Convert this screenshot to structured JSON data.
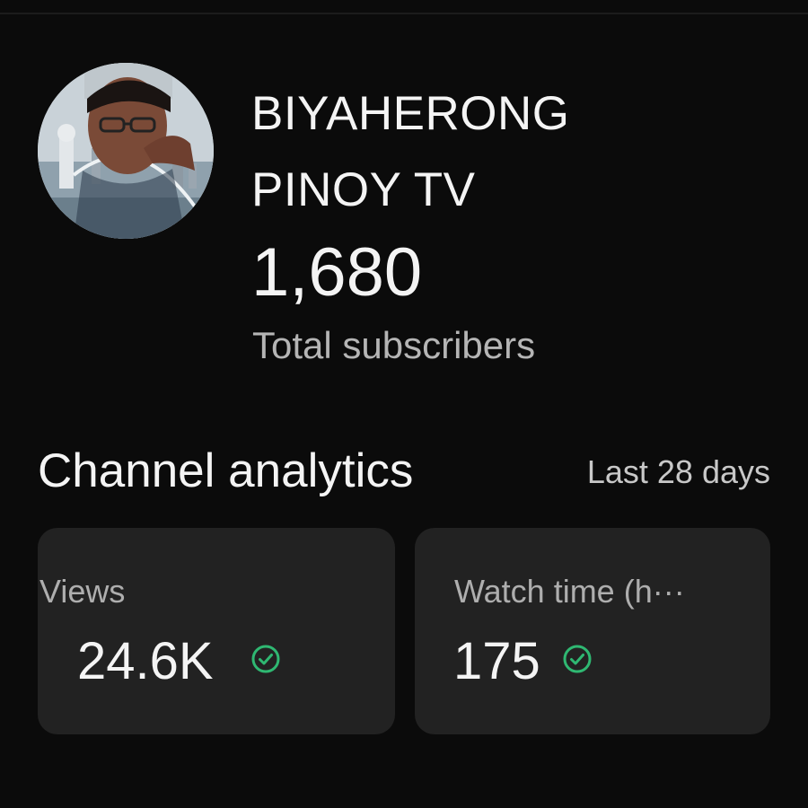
{
  "channel": {
    "name_line1": "BIYAHERONG",
    "name_line2": "PINOY TV",
    "subscriber_count": "1,680",
    "subscriber_label": "Total subscribers",
    "avatar_icon": "channel-avatar-photo"
  },
  "analytics": {
    "title": "Channel analytics",
    "period": "Last 28 days",
    "cards": [
      {
        "label": "Views",
        "value": "24.6K",
        "status_icon": "check-circle-icon"
      },
      {
        "label": "Watch time (h···",
        "value": "175",
        "status_icon": "check-circle-icon"
      }
    ]
  },
  "colors": {
    "background": "#0b0b0b",
    "card_background": "#222222",
    "primary_text": "#f4f4f4",
    "secondary_text": "#b5b5b5",
    "check_green": "#2fb872"
  }
}
